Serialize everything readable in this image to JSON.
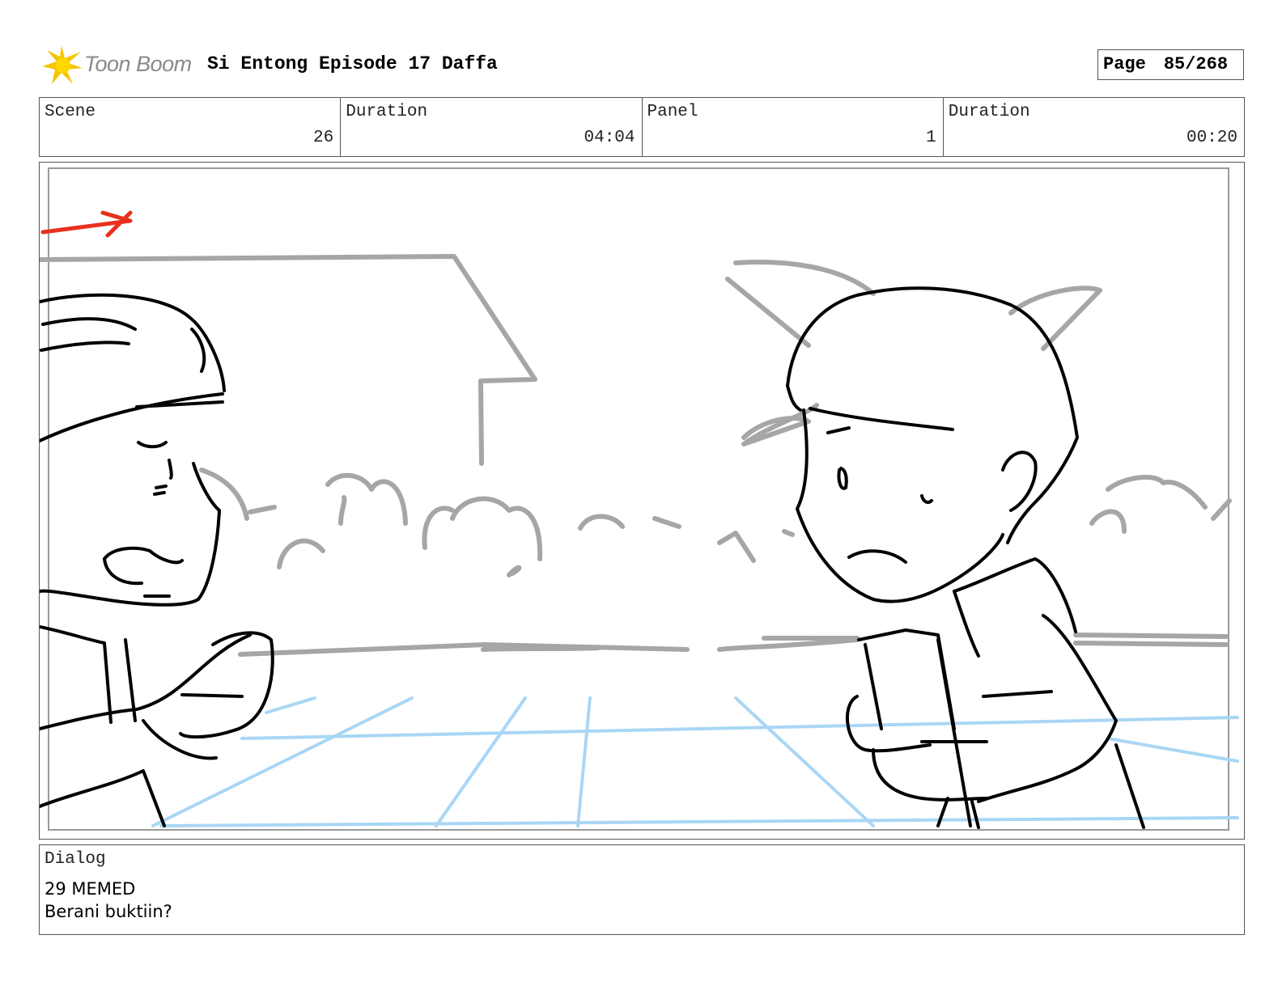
{
  "header": {
    "logo_text": "Toon Boom",
    "title": "Si Entong Episode 17 Daffa",
    "page_label": "Page",
    "page_value": "85/268"
  },
  "info": [
    {
      "label": "Scene",
      "value": "26"
    },
    {
      "label": "Duration",
      "value": "04:04"
    },
    {
      "label": "Panel",
      "value": "1"
    },
    {
      "label": "Duration",
      "value": "00:20"
    }
  ],
  "dialog": {
    "label": "Dialog",
    "line1": "29 MEMED",
    "line2": "Berani buktiin?"
  },
  "colors": {
    "logo_star": "#f5c400",
    "sketch_ink": "#000000",
    "background_ink": "#a6a6a6",
    "perspective_grid": "#a9d6f5",
    "camera_arrow": "#e8301c"
  }
}
